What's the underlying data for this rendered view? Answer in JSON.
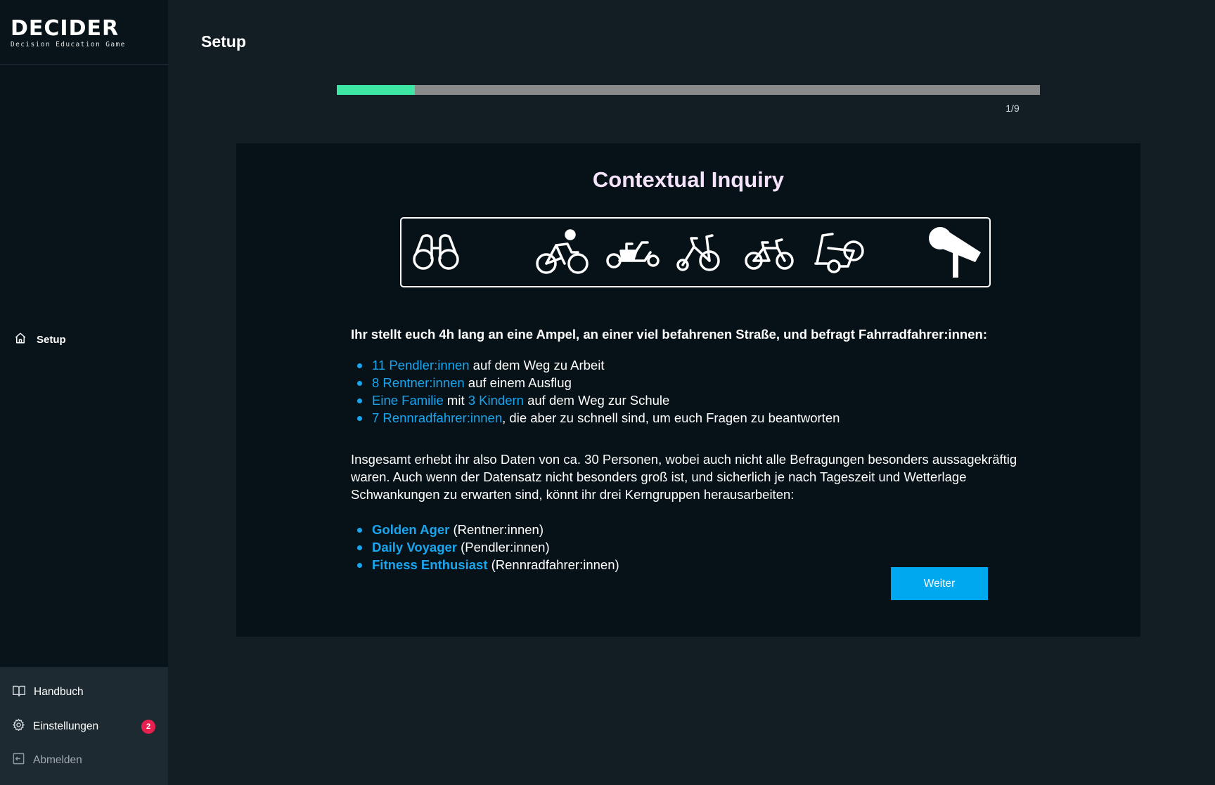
{
  "app": {
    "logo_title": "DECIDER",
    "logo_subtitle": "Decision Education Game"
  },
  "sidebar": {
    "nav": [
      {
        "label": "Setup",
        "icon": "home-icon"
      }
    ],
    "bottom": [
      {
        "label": "Handbuch",
        "icon": "book-icon"
      },
      {
        "label": "Einstellungen",
        "icon": "gear-icon",
        "badge": "2"
      },
      {
        "label": "Abmelden",
        "icon": "logout-icon"
      }
    ]
  },
  "header": {
    "title": "Setup"
  },
  "progress": {
    "label": "1/9",
    "current": 1,
    "total": 9
  },
  "card": {
    "title": "Contextual Inquiry",
    "icons": [
      "binoculars-icon",
      "cyclist-icon",
      "cargo-bike-icon",
      "tricycle-icon",
      "kids-bike-icon",
      "scooter-icon",
      "microphone-icon"
    ],
    "intro": "Ihr stellt euch 4h lang an eine Ampel, an einer viel befahrenen Straße, und befragt Fahrradfahrer:innen:",
    "list1": [
      {
        "hl": "11 Pendler:innen",
        "rest": " auf dem Weg zu Arbeit"
      },
      {
        "hl": "8 Rentner:innen",
        "rest": " auf einem Ausflug"
      },
      {
        "hl": "Eine Familie",
        "mid": " mit ",
        "hl2": "3 Kindern",
        "rest": " auf dem Weg zur Schule"
      },
      {
        "hl": "7 Rennradfahrer:innen",
        "rest": ", die aber zu schnell sind, um euch Fragen zu beantworten"
      }
    ],
    "paragraph": "Insgesamt erhebt ihr also Daten von ca. 30 Personen, wobei auch nicht alle Befragungen besonders aussagekräftig waren. Auch wenn der Datensatz nicht besonders groß ist, und sicherlich je nach Tageszeit und Wetterlage Schwankungen zu erwarten sind, könnt ihr drei Kerngruppen herausarbeiten:",
    "list2": [
      {
        "hl": "Golden Ager",
        "rest": " (Rentner:innen)"
      },
      {
        "hl": "Daily Voyager",
        "rest": " (Pendler:innen)"
      },
      {
        "hl": "Fitness Enthusiast",
        "rest": " (Rennradfahrer:innen)"
      }
    ],
    "button": "Weiter"
  },
  "colors": {
    "accent": "#19a6ef",
    "progress": "#3ee6a3",
    "badge": "#e8204f",
    "button": "#00a8f0",
    "title": "#f4e3fb"
  }
}
